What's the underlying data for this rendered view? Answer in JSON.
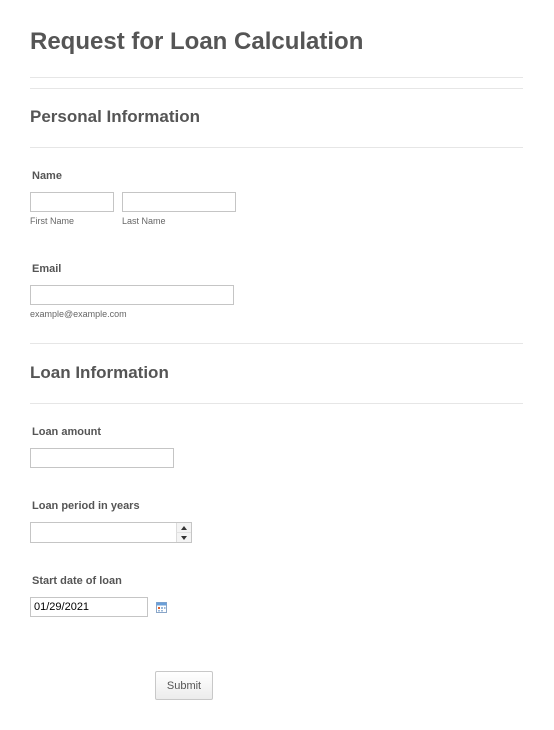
{
  "form": {
    "title": "Request for Loan Calculation",
    "submit_label": "Submit"
  },
  "personal": {
    "heading": "Personal Information",
    "name": {
      "label": "Name",
      "first_value": "",
      "last_value": "",
      "first_sublabel": "First Name",
      "last_sublabel": "Last Name"
    },
    "email": {
      "label": "Email",
      "value": "",
      "sublabel": "example@example.com"
    }
  },
  "loan": {
    "heading": "Loan Information",
    "amount": {
      "label": "Loan amount",
      "value": ""
    },
    "period": {
      "label": "Loan period in years",
      "value": ""
    },
    "start_date": {
      "label": "Start date of loan",
      "value": "01/29/2021"
    }
  },
  "icons": {
    "spinner_up": "arrow-up-icon",
    "spinner_down": "arrow-down-icon",
    "calendar": "calendar-icon"
  },
  "colors": {
    "text": "#555555",
    "divider": "#e6e6e6",
    "input_border": "#c5c5c5",
    "calendar_accent": "#e0602a",
    "calendar_blue": "#6a9fd8"
  }
}
